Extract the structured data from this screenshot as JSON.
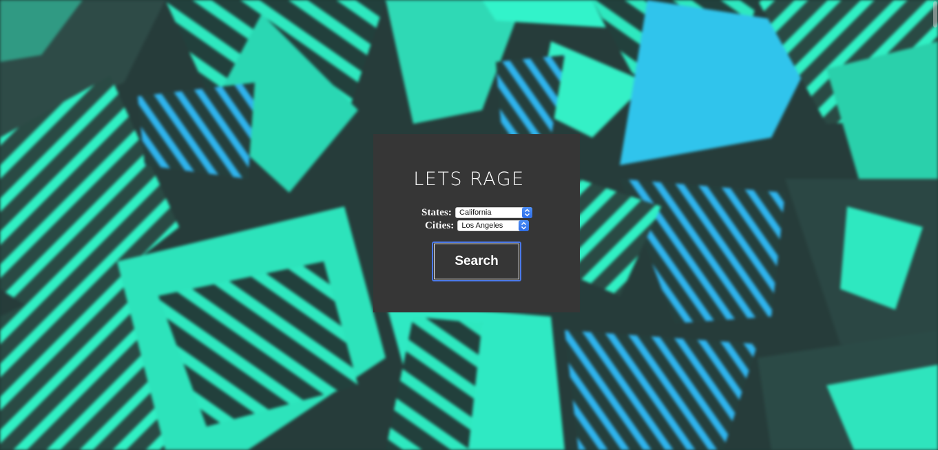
{
  "brand": {
    "logo_text": "LETS RAGE"
  },
  "form": {
    "states_label": "States:",
    "states_selected": "California",
    "cities_label": "Cities:",
    "cities_selected": "Los Angeles",
    "search_label": "Search"
  },
  "colors": {
    "panel": "#363636",
    "accent_green": "#2ff5c8",
    "accent_blue": "#2fb8f0",
    "focus_ring": "#4a78e8"
  },
  "icons": {
    "stepper": "chevron-up-down-icon"
  }
}
